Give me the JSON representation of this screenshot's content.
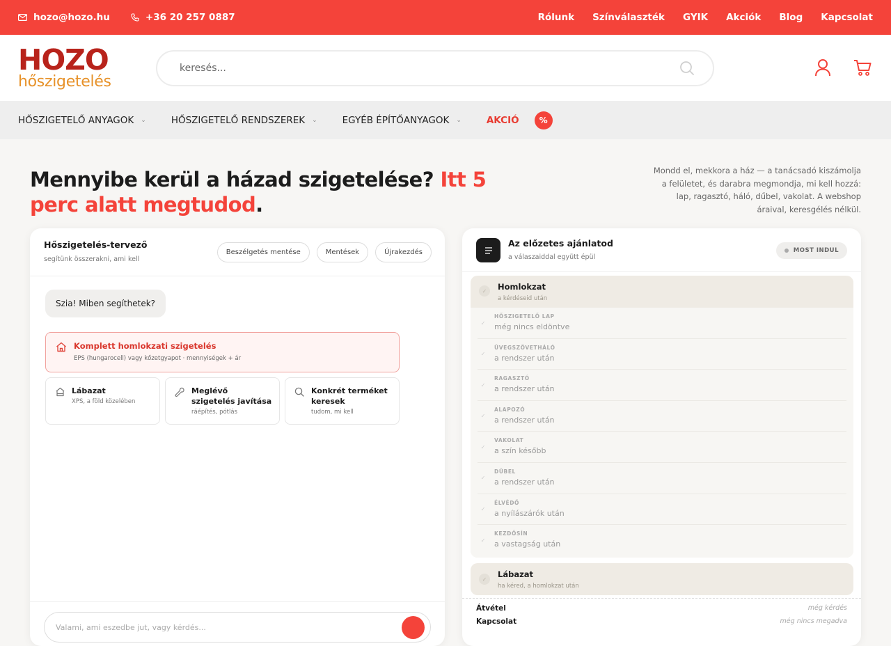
{
  "topbar": {
    "email": "hozo@hozo.hu",
    "phone": "+36 20 257 0887",
    "links": [
      "Rólunk",
      "Színválaszték",
      "GYIK",
      "Akciók",
      "Blog",
      "Kapcsolat"
    ]
  },
  "logo": {
    "line1": "HOZO",
    "line2": "hőszigetelés"
  },
  "search": {
    "placeholder": "keresés..."
  },
  "nav": {
    "items": [
      "HŐSZIGETELŐ ANYAGOK",
      "HŐSZIGETELŐ RENDSZEREK",
      "EGYÉB ÉPÍTŐANYAGOK"
    ],
    "akcio": "AKCIÓ",
    "akcio_badge": "%"
  },
  "hero": {
    "title_part1": "Mennyibe kerül a házad szigetelése? ",
    "title_highlight": "Itt 5 perc alatt megtudod",
    "title_end": ".",
    "side_text": "Mondd el, mekkora a ház — a tanácsadó kiszámolja a felületet, és darabra megmondja, mi kell hozzá: lap, ragasztó, háló, dűbel, vakolat. A webshop áraival, keresgélés nélkül."
  },
  "planner": {
    "title": "Hőszigetelés-tervező",
    "subtitle": "segítünk összerakni, ami kell",
    "buttons": [
      "Beszélgetés mentése",
      "Mentések",
      "Újrakezdés"
    ],
    "greeting": "Szia! Miben segíthetek?",
    "main_option": {
      "title": "Komplett homlokzati szigetelés",
      "subtitle": "EPS (hungarocell) vagy kőzetgyapot · mennyiségek + ár"
    },
    "options": [
      {
        "title": "Lábazat",
        "subtitle": "XPS, a föld közelében"
      },
      {
        "title": "Meglévő szigetelés javítása",
        "subtitle": "ráépítés, pótlás"
      },
      {
        "title": "Konkrét terméket keresek",
        "subtitle": "tudom, mi kell"
      }
    ],
    "input_placeholder": "Valami, ami eszedbe jut, vagy kérdés..."
  },
  "offer": {
    "title": "Az előzetes ajánlatod",
    "subtitle": "a válaszaiddal együtt épül",
    "status": "MOST INDUL",
    "section1": {
      "title": "Homlokzat",
      "subtitle": "a kérdéseid után"
    },
    "items": [
      {
        "label": "Hőszigetelő lap",
        "value": "még nincs eldöntve"
      },
      {
        "label": "Üvegszövetháló",
        "value": "a rendszer után"
      },
      {
        "label": "Ragasztó",
        "value": "a rendszer után"
      },
      {
        "label": "Alapozó",
        "value": "a rendszer után"
      },
      {
        "label": "Vakolat",
        "value": "a szín később"
      },
      {
        "label": "Dűbel",
        "value": "a rendszer után"
      },
      {
        "label": "Élvédő",
        "value": "a nyílászárók után"
      },
      {
        "label": "Kezdősín",
        "value": "a vastagság után"
      }
    ],
    "section2": {
      "title": "Lábazat",
      "subtitle": "ha kéred, a homlokzat után"
    },
    "footer": [
      {
        "key": "Átvétel",
        "value": "még kérdés"
      },
      {
        "key": "Kapcsolat",
        "value": "még nincs megadva"
      }
    ]
  },
  "colors": {
    "brand_red": "#f4433a",
    "logo_red": "#b8231b",
    "logo_orange": "#e7922a"
  }
}
